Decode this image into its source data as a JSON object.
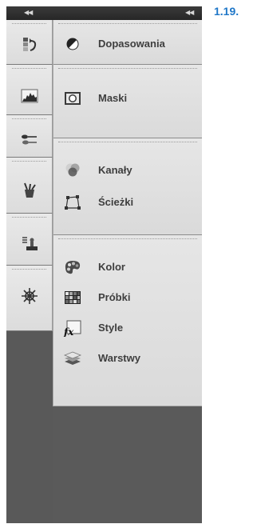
{
  "figure_label": "1.19.",
  "topbar": {
    "collapse_left": "◀◀",
    "collapse_right": "◀◀"
  },
  "left_icons": [
    {
      "name": "history-icon"
    },
    {
      "name": "histogram-icon"
    },
    {
      "name": "brush-presets-icon"
    },
    {
      "name": "tool-presets-icon"
    },
    {
      "name": "clone-source-icon"
    },
    {
      "name": "navigator-icon"
    }
  ],
  "panels": {
    "group1": [
      {
        "label": "Dopasowania",
        "icon": "adjustments-icon"
      }
    ],
    "group2": [
      {
        "label": "Maski",
        "icon": "masks-icon"
      }
    ],
    "group3": [
      {
        "label": "Kanały",
        "icon": "channels-icon"
      },
      {
        "label": "Ścieżki",
        "icon": "paths-icon"
      }
    ],
    "group4": [
      {
        "label": "Kolor",
        "icon": "color-icon"
      },
      {
        "label": "Próbki",
        "icon": "swatches-icon"
      },
      {
        "label": "Style",
        "icon": "styles-icon"
      },
      {
        "label": "Warstwy",
        "icon": "layers-icon"
      }
    ]
  },
  "colors": {
    "figure_label": "#1f77c8",
    "panel_bg": "#dedede",
    "dock_bg": "#5a5a5a"
  }
}
